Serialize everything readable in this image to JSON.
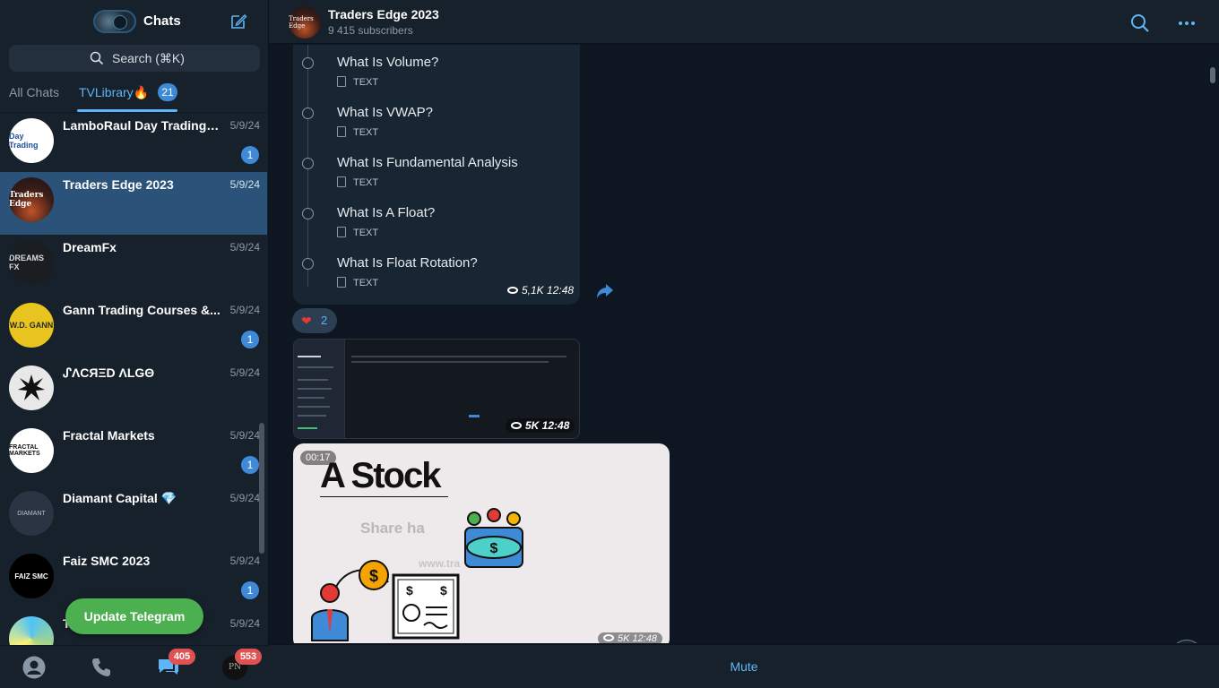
{
  "sidebar": {
    "title": "Chats",
    "search_placeholder": "Search (⌘K)",
    "folders": [
      {
        "label": "All Chats"
      },
      {
        "label": "TVLibrary🔥",
        "badge": "21"
      }
    ],
    "chats": [
      {
        "name": "LamboRaul Day Trading I...",
        "date": "5/9/24",
        "unread": "1",
        "avatar_text": "Day Trading"
      },
      {
        "name": "Traders Edge 2023",
        "date": "5/9/24",
        "unread": "",
        "avatar_text": "Traders Edge"
      },
      {
        "name": "DreamFx",
        "date": "5/9/24",
        "unread": "",
        "avatar_text": "DREAMS FX"
      },
      {
        "name": "Gann Trading Courses &...",
        "date": "5/9/24",
        "unread": "1",
        "avatar_text": "W.D. GANN"
      },
      {
        "name": "ᔑΛCЯΞD ΛLGΘ",
        "date": "5/9/24",
        "unread": "",
        "avatar_text": ""
      },
      {
        "name": "Fractal Markets",
        "date": "5/9/24",
        "unread": "1",
        "avatar_text": "FRACTAL MARKETS"
      },
      {
        "name": "Diamant Capital 💎",
        "date": "5/9/24",
        "unread": "",
        "avatar_text": "DIAMANT"
      },
      {
        "name": "Faiz SMC 2023",
        "date": "5/9/24",
        "unread": "1",
        "avatar_text": "FAIZ SMC"
      },
      {
        "name": "T",
        "date": "5/9/24",
        "unread": "",
        "avatar_text": ""
      }
    ],
    "update_button": "Update Telegram",
    "nav_badges": {
      "chats": "405",
      "profile": "553"
    }
  },
  "channel": {
    "title": "Traders Edge 2023",
    "subscribers": "9 415 subscribers",
    "avatar_text": "Traders Edge"
  },
  "messages": {
    "list_items": [
      {
        "title": "What Is Volume?",
        "tag": "TEXT"
      },
      {
        "title": "What Is VWAP?",
        "tag": "TEXT"
      },
      {
        "title": "What Is Fundamental Analysis",
        "tag": "TEXT"
      },
      {
        "title": "What Is A Float?",
        "tag": "TEXT"
      },
      {
        "title": "What Is Float Rotation?",
        "tag": "TEXT"
      }
    ],
    "list_meta": "5,1K 12:48",
    "reaction_count": "2",
    "screenshot_meta": "5K 12:48",
    "video": {
      "duration": "00:17",
      "title": "A Stock",
      "subtitle": "Share ha",
      "url": "www.tra",
      "meta": "5K 12:48"
    }
  },
  "footer": {
    "mute": "Mute"
  },
  "colors": {
    "accent": "#5eb5f7",
    "active_row": "#2b5278",
    "badge": "#3e8ad6",
    "update": "#4caf50",
    "alert_badge": "#e05252"
  }
}
